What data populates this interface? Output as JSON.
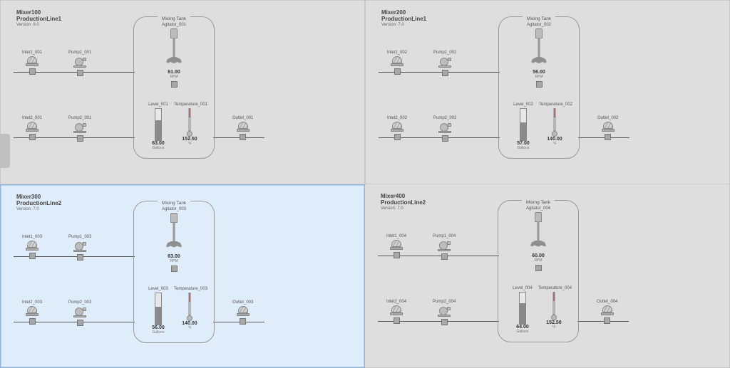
{
  "labels": {
    "tank_title": "Mixing Tank",
    "agitator_unit": "RPM",
    "level_unit": "Gallons",
    "temp_unit": "°F"
  },
  "panels": [
    {
      "id": "Mixer100",
      "line": "ProductionLine1",
      "version": "Version: 9.0",
      "selected": false,
      "agitator": {
        "name": "Agitator_001",
        "value": "61.00"
      },
      "level": {
        "name": "Level_001",
        "value": "63.00",
        "pct": 63
      },
      "temp": {
        "name": "Temperature_001",
        "value": "152.50"
      },
      "inlet1": {
        "name": "Inlet1_001"
      },
      "pump1": {
        "name": "Pump1_001"
      },
      "inlet2": {
        "name": "Inlet2_001"
      },
      "pump2": {
        "name": "Pump2_001"
      },
      "outlet": {
        "name": "Outlet_001"
      }
    },
    {
      "id": "Mixer200",
      "line": "ProductionLine1",
      "version": "Version: 7.0",
      "selected": false,
      "agitator": {
        "name": "Agitator_002",
        "value": "56.00"
      },
      "level": {
        "name": "Level_002",
        "value": "57.00",
        "pct": 57
      },
      "temp": {
        "name": "Temperature_002",
        "value": "140.00"
      },
      "inlet1": {
        "name": "Inlet1_002"
      },
      "pump1": {
        "name": "Pump1_002"
      },
      "inlet2": {
        "name": "Inlet2_002"
      },
      "pump2": {
        "name": "Pump2_002"
      },
      "outlet": {
        "name": "Outlet_002"
      }
    },
    {
      "id": "Mixer300",
      "line": "ProductionLine2",
      "version": "Version: 7.0",
      "selected": true,
      "agitator": {
        "name": "Agitator_003",
        "value": "63.00"
      },
      "level": {
        "name": "Level_003",
        "value": "56.00",
        "pct": 56
      },
      "temp": {
        "name": "Temperature_003",
        "value": "140.00"
      },
      "inlet1": {
        "name": "Inlet1_003"
      },
      "pump1": {
        "name": "Pump1_003"
      },
      "inlet2": {
        "name": "Inlet2_003"
      },
      "pump2": {
        "name": "Pump2_003"
      },
      "outlet": {
        "name": "Outlet_003"
      }
    },
    {
      "id": "Mixer400",
      "line": "ProductionLine2",
      "version": "Version: 7.0",
      "selected": false,
      "agitator": {
        "name": "Agitator_004",
        "value": "60.00"
      },
      "level": {
        "name": "Level_004",
        "value": "64.00",
        "pct": 64
      },
      "temp": {
        "name": "Temperature_004",
        "value": "152.50"
      },
      "inlet1": {
        "name": "Inlet1_004"
      },
      "pump1": {
        "name": "Pump1_004"
      },
      "inlet2": {
        "name": "Inlet2_004"
      },
      "pump2": {
        "name": "Pump2_004"
      },
      "outlet": {
        "name": "Outlet_004"
      }
    }
  ]
}
